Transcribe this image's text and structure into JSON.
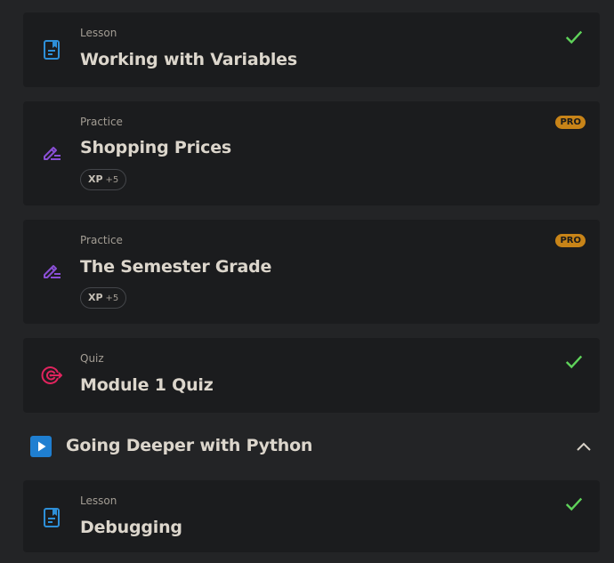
{
  "items": [
    {
      "type": "Lesson",
      "title": "Working with Variables",
      "status": "completed",
      "icon": "lesson-icon"
    },
    {
      "type": "Practice",
      "title": "Shopping Prices",
      "badge": "PRO",
      "xp_label": "XP",
      "xp_value": "+5",
      "icon": "practice-icon"
    },
    {
      "type": "Practice",
      "title": "The Semester Grade",
      "badge": "PRO",
      "xp_label": "XP",
      "xp_value": "+5",
      "icon": "practice-icon"
    },
    {
      "type": "Quiz",
      "title": "Module 1 Quiz",
      "status": "completed",
      "icon": "quiz-icon"
    }
  ],
  "section": {
    "title": "Going Deeper with Python",
    "icon": "play-icon",
    "expanded": true
  },
  "section_items": [
    {
      "type": "Lesson",
      "title": "Debugging",
      "status": "completed",
      "icon": "lesson-icon"
    }
  ],
  "colors": {
    "background": "#232426",
    "card": "#1b1c1e",
    "lesson_icon": "#2e8fd8",
    "practice_icon": "#8a4fd6",
    "quiz_icon": "#e0245e",
    "check": "#5fd35a",
    "pro_badge": "#c88418",
    "section_icon": "#1f7fd1"
  }
}
